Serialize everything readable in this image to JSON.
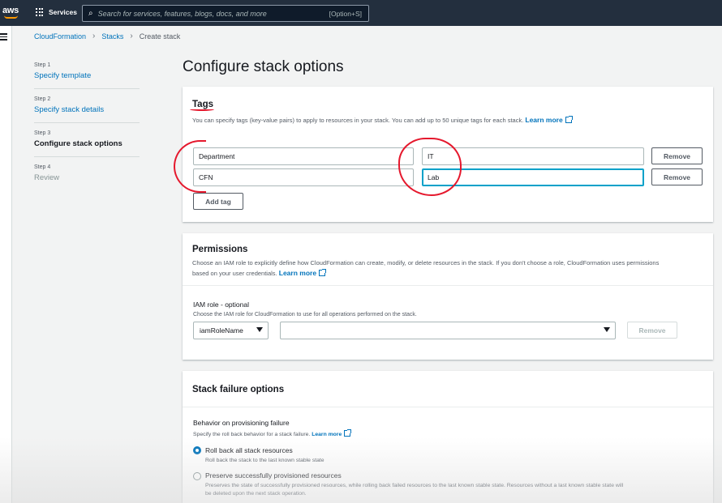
{
  "topnav": {
    "logo": "aws",
    "services_label": "Services",
    "search_placeholder": "Search for services, features, blogs, docs, and more",
    "search_shortcut": "[Option+S]"
  },
  "breadcrumb": [
    "CloudFormation",
    "Stacks",
    "Create stack"
  ],
  "steps": [
    {
      "num": "Step 1",
      "title": "Specify template"
    },
    {
      "num": "Step 2",
      "title": "Specify stack details"
    },
    {
      "num": "Step 3",
      "title": "Configure stack options"
    },
    {
      "num": "Step 4",
      "title": "Review"
    }
  ],
  "page_title": "Configure stack options",
  "tags": {
    "heading": "Tags",
    "description": "You can specify tags (key-value pairs) to apply to resources in your stack. You can add up to 50 unique tags for each stack.",
    "learn_more": "Learn more",
    "rows": [
      {
        "key": "Department",
        "value": "IT",
        "remove": "Remove"
      },
      {
        "key": "CFN",
        "value": "Lab",
        "remove": "Remove"
      }
    ],
    "add_tag": "Add tag"
  },
  "permissions": {
    "heading": "Permissions",
    "description_1": "Choose an IAM role to explicitly define how CloudFormation can create, modify, or delete resources in the stack. If you don't choose a role, CloudFormation uses permissions",
    "description_2": "based on your user credentials.",
    "learn_more": "Learn more",
    "iam_label": "IAM role - optional",
    "iam_desc": "Choose the IAM role for CloudFormation to use for all operations performed on the stack.",
    "iam_type": "iamRoleName",
    "iam_value": "",
    "remove": "Remove"
  },
  "failure": {
    "heading": "Stack failure options",
    "behavior_label": "Behavior on provisioning failure",
    "behavior_desc": "Specify the roll back behavior for a stack failure.",
    "learn_more": "Learn more",
    "options": [
      {
        "label": "Roll back all stack resources",
        "desc": "Roll back the stack to the last known stable state",
        "checked": true
      },
      {
        "label": "Preserve successfully provisioned resources",
        "desc_1": "Preserves the state of successfully provisioned resources, while rolling back failed resources to the last known stable state. Resources without a last known stable state will",
        "desc_2": "be deleted upon the next stack operation.",
        "checked": false
      }
    ]
  },
  "colors": {
    "nav_bg": "#232f3e",
    "link": "#0073bb",
    "annotation": "#e5182d",
    "focus": "#00a1c9"
  }
}
